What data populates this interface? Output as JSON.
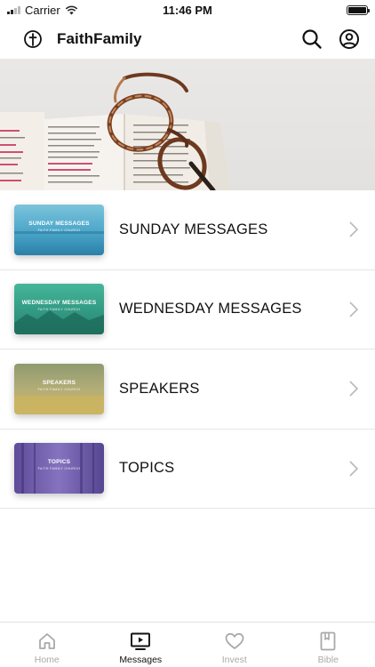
{
  "status_bar": {
    "carrier": "Carrier",
    "time": "11:46 PM"
  },
  "header": {
    "title": "FaithFamily",
    "logo_icon": "cross-circle-icon",
    "search_icon": "search-icon",
    "profile_icon": "profile-circle-icon"
  },
  "hero": {
    "image": "open-bible-with-glasses-photo"
  },
  "message_categories": [
    {
      "label": "SUNDAY MESSAGES",
      "thumb_title": "SUNDAY MESSAGES",
      "thumb_subtitle": "FAITH FAMILY CHURCH",
      "thumb_colors": [
        "#5fb2cf",
        "#2f86ad"
      ]
    },
    {
      "label": "WEDNESDAY MESSAGES",
      "thumb_title": "WEDNESDAY MESSAGES",
      "thumb_subtitle": "FAITH FAMILY CHURCH",
      "thumb_colors": [
        "#3fae95",
        "#1f7a6a"
      ]
    },
    {
      "label": "SPEAKERS",
      "thumb_title": "SPEAKERS",
      "thumb_subtitle": "FAITH FAMILY CHURCH",
      "thumb_colors": [
        "#a9ae78",
        "#c4b56a"
      ]
    },
    {
      "label": "TOPICS",
      "thumb_title": "TOPICS",
      "thumb_subtitle": "FAITH FAMILY CHURCH",
      "thumb_colors": [
        "#7b67b1",
        "#58488f"
      ]
    }
  ],
  "tabs": [
    {
      "label": "Home",
      "icon": "home-icon",
      "active": false
    },
    {
      "label": "Messages",
      "icon": "video-play-icon",
      "active": true
    },
    {
      "label": "Invest",
      "icon": "heart-icon",
      "active": false
    },
    {
      "label": "Bible",
      "icon": "bible-book-icon",
      "active": false
    }
  ],
  "colors": {
    "active_tab": "#111111",
    "inactive_tab": "#a9a9a9",
    "divider": "#e6e6e6"
  }
}
